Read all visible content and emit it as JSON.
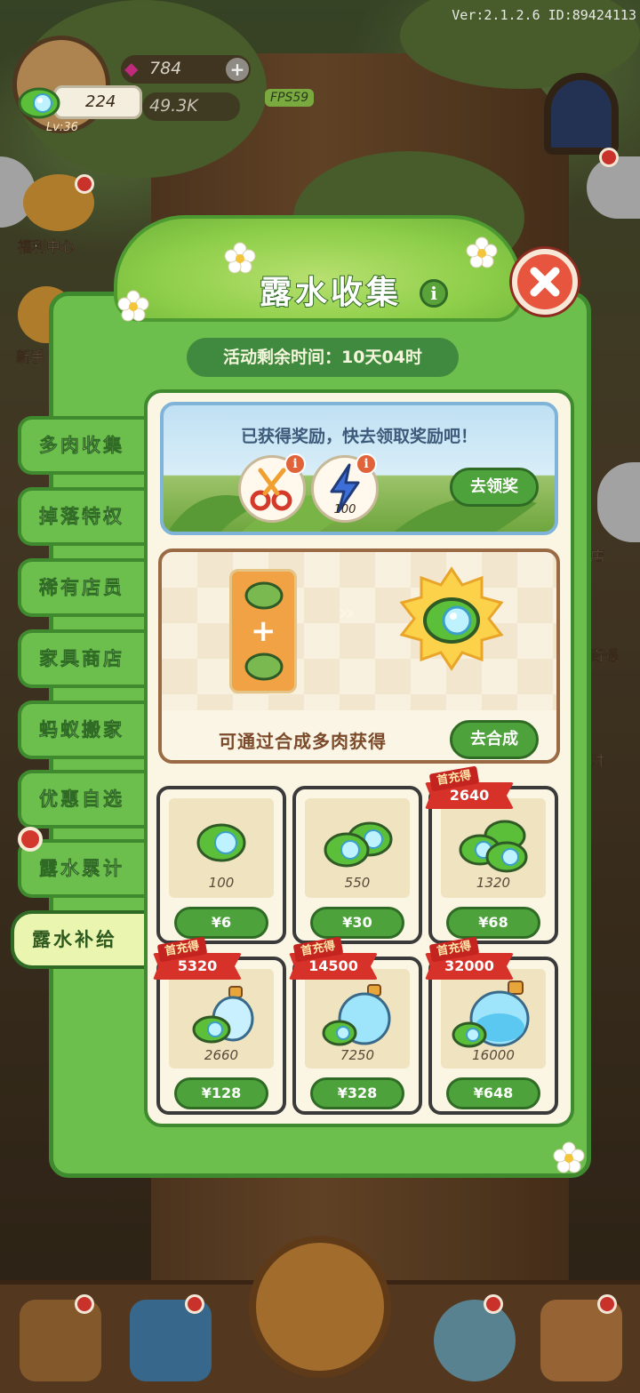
{
  "version": "Ver:2.1.2.6 ID:89424113",
  "hud": {
    "gems": "784",
    "dew": "224",
    "coins": "49.3K",
    "fps": "FPS59",
    "level": "Lv:36"
  },
  "side_buttons": {
    "welfare": "福利中心",
    "newbie": "新手",
    "shop": "店",
    "deal": "奇遇",
    "time": "时"
  },
  "modal": {
    "title": "露水收集",
    "timer": "活动剩余时间：10天04时",
    "tabs": [
      {
        "label": "多肉收集",
        "active": false
      },
      {
        "label": "掉落特权",
        "active": false
      },
      {
        "label": "稀有店员",
        "active": false
      },
      {
        "label": "家具商店",
        "active": false
      },
      {
        "label": "蚂蚁搬家",
        "active": false
      },
      {
        "label": "优惠自选",
        "active": false
      },
      {
        "label": "露水累计",
        "active": false
      },
      {
        "label": "露水补给",
        "active": true
      }
    ],
    "reward": {
      "text": "已获得奖励，快去领取奖励吧！",
      "item_count": "100",
      "button": "去领奖"
    },
    "merge": {
      "text": "可通过合成多肉获得",
      "button": "去合成"
    },
    "shop": {
      "first_charge_tag": "首充得",
      "items": [
        {
          "qty": "100",
          "price": "¥6",
          "bonus": ""
        },
        {
          "qty": "550",
          "price": "¥30",
          "bonus": ""
        },
        {
          "qty": "1320",
          "price": "¥68",
          "bonus": "2640"
        },
        {
          "qty": "2660",
          "price": "¥128",
          "bonus": "5320"
        },
        {
          "qty": "7250",
          "price": "¥328",
          "bonus": "14500"
        },
        {
          "qty": "16000",
          "price": "¥648",
          "bonus": "32000"
        }
      ]
    }
  },
  "colors": {
    "panel_green": "#6cbf4c",
    "button_green": "#4ea23c",
    "ribbon_red": "#d6322a",
    "close_red": "#e8553f"
  }
}
